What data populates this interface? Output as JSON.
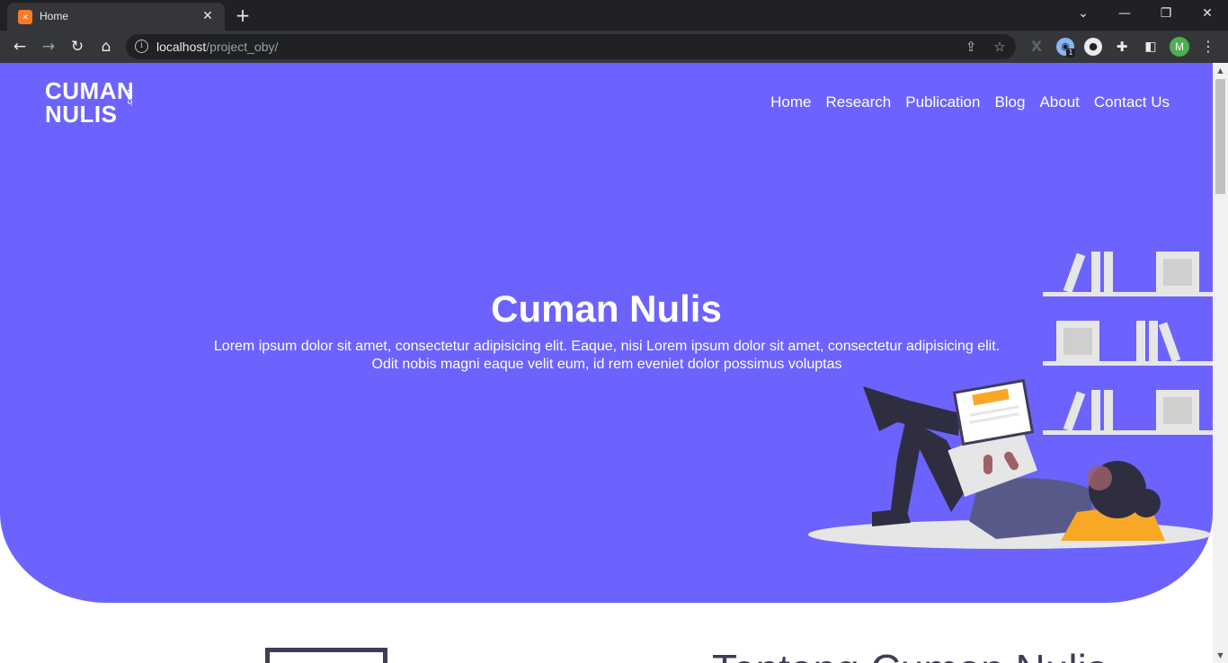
{
  "browser": {
    "tab_title": "Home",
    "favicon_label": "✕",
    "url_host": "localhost",
    "url_path": "/project_oby/",
    "extension_badge": "1",
    "profile_initial": "M"
  },
  "site": {
    "logo_line1": "CUMAN",
    "logo_line2": "NULIS",
    "logo_suffix": ".COM",
    "nav": [
      "Home",
      "Research",
      "Publication",
      "Blog",
      "About",
      "Contact Us"
    ],
    "hero_title": "Cuman Nulis",
    "hero_subtitle": "Lorem ipsum dolor sit amet, consectetur adipisicing elit. Eaque, nisi Lorem ipsum dolor sit amet, consectetur adipisicing elit. Odit nobis magni eaque velit eum, id rem eveniet dolor possimus voluptas",
    "section_title": "Tentang Cuman Nulis"
  },
  "colors": {
    "hero_bg": "#6c63ff",
    "chrome_dark": "#202124",
    "chrome_mid": "#35363a",
    "illustration_dark": "#2f2e41",
    "illustration_accent": "#f9a826",
    "illustration_light": "#e6e6e6"
  },
  "icons": [
    "back-arrow-icon",
    "forward-arrow-icon",
    "reload-icon",
    "home-icon",
    "info-icon",
    "share-icon",
    "bookmark-star-icon",
    "extensions-puzzle-icon",
    "side-panel-icon",
    "menu-kebab-icon"
  ]
}
